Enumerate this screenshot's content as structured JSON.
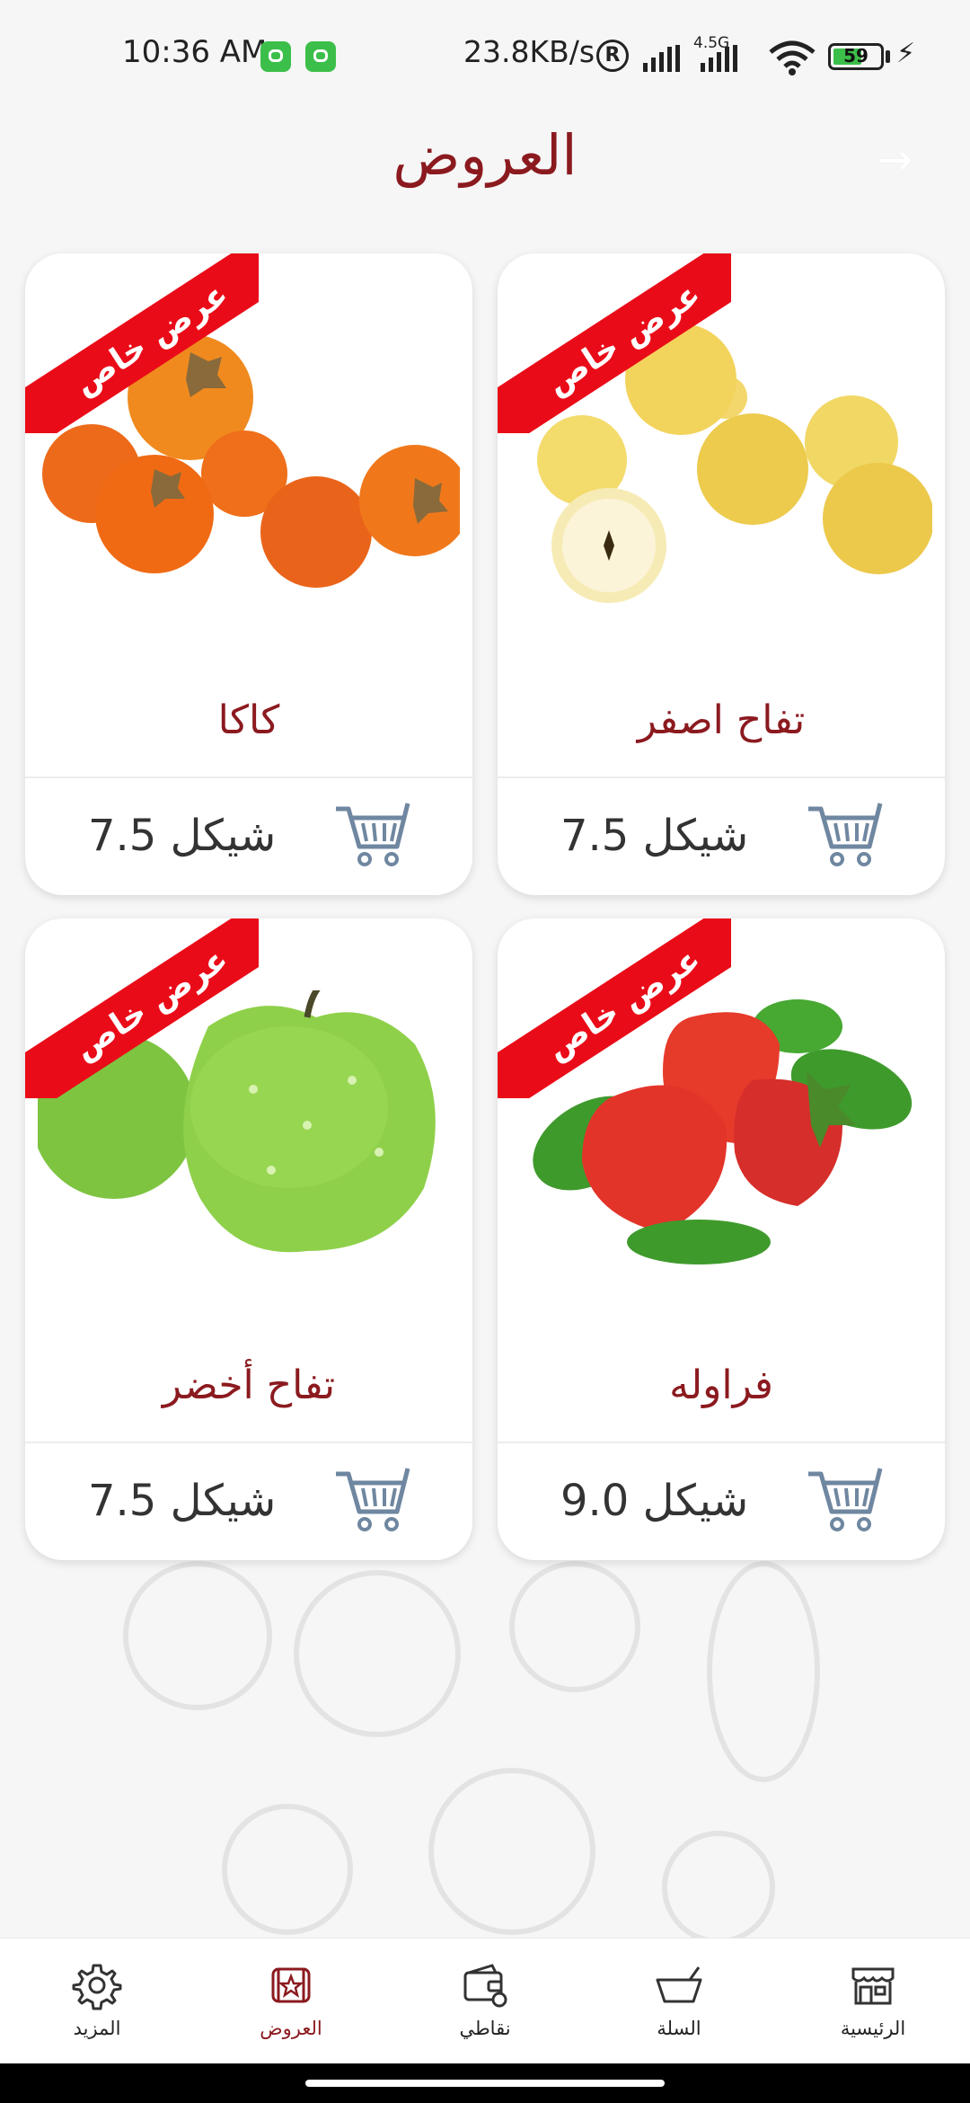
{
  "status_bar": {
    "time": "10:36 AM",
    "speed": "23.8KB/s",
    "registered_mark": "R",
    "network": "4.5G",
    "battery": "59",
    "battery_color": "#3cbf4a"
  },
  "header": {
    "title": "العروض",
    "back_icon": "arrow-right-icon"
  },
  "colors": {
    "accent": "#8b1a1f",
    "ribbon": "#ea0b18",
    "cart_icon": "#6f87a0"
  },
  "products": [
    {
      "name": "تفاح اصفر",
      "price": "7.5 شيكل",
      "badge": "عرض خاص",
      "image": "yellow-apples-image"
    },
    {
      "name": "كاكا",
      "price": "7.5 شيكل",
      "badge": "عرض خاص",
      "image": "persimmons-image"
    },
    {
      "name": "فراوله",
      "price": "9.0 شيكل",
      "badge": "عرض خاص",
      "image": "strawberries-image"
    },
    {
      "name": "تفاح أخضر",
      "price": "7.5 شيكل",
      "badge": "عرض خاص",
      "image": "green-apples-image"
    }
  ],
  "bottom_nav": {
    "items": [
      {
        "label": "الرئيسية",
        "icon": "store-icon"
      },
      {
        "label": "السلة",
        "icon": "basket-icon"
      },
      {
        "label": "نقاطي",
        "icon": "wallet-icon"
      },
      {
        "label": "العروض",
        "icon": "offers-icon",
        "active": true
      },
      {
        "label": "المزيد",
        "icon": "gear-icon"
      }
    ]
  }
}
